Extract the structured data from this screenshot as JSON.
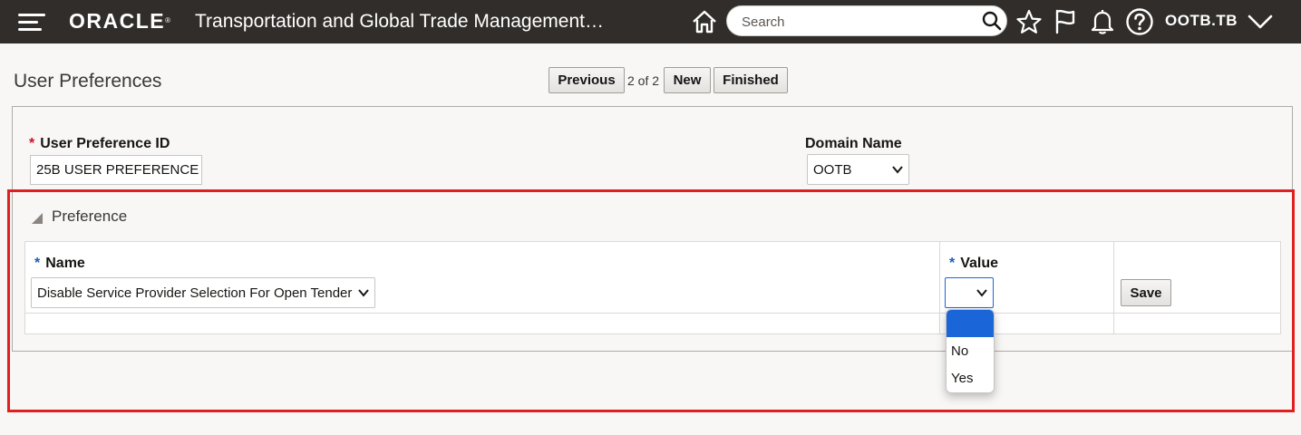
{
  "header": {
    "logo": "ORACLE",
    "app_title": "Transportation and Global Trade Management…",
    "search_placeholder": "Search",
    "user": "OOTB.TB"
  },
  "page": {
    "title": "User Preferences",
    "nav": {
      "previous": "Previous",
      "counter": "2 of 2",
      "new": "New",
      "finished": "Finished"
    }
  },
  "form": {
    "pref_id_label": "User Preference ID",
    "pref_id_value": "25B USER PREFERENCE",
    "domain_label": "Domain Name",
    "domain_value": "OOTB"
  },
  "preference_section": {
    "title": "Preference",
    "name_label": "Name",
    "name_value": "Disable Service Provider Selection For Open Tender",
    "value_label": "Value",
    "value_selected": "",
    "save": "Save",
    "options": [
      "",
      "No",
      "Yes"
    ]
  }
}
